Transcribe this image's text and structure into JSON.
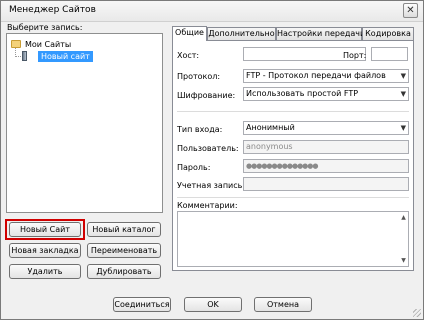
{
  "window": {
    "title": "Менеджер Сайтов",
    "close_glyph": "✕"
  },
  "left": {
    "select_label": "Выберите запись:",
    "tree": [
      {
        "label": "Мои Сайты",
        "icon": "folder-icon"
      },
      {
        "label": "Новый сайт",
        "icon": "site-icon",
        "selected": true
      }
    ],
    "buttons": {
      "new_site": "Новый Сайт",
      "new_folder": "Новый каталог",
      "new_bookmark": "Новая закладка",
      "rename": "Переименовать",
      "delete": "Удалить",
      "duplicate": "Дублировать"
    }
  },
  "tabs": [
    "Общие",
    "Дополнительно",
    "Настройки передачи",
    "Кодировка"
  ],
  "general": {
    "host_label": "Хост:",
    "host_value": "",
    "port_label": "Порт:",
    "port_value": "",
    "protocol_label": "Протокол:",
    "protocol_value": "FTP - Протокол передачи файлов",
    "encryption_label": "Шифрование:",
    "encryption_value": "Использовать простой FTP",
    "logon_label": "Тип входа:",
    "logon_value": "Анонимный",
    "user_label": "Пользователь:",
    "user_value": "anonymous",
    "password_label": "Пароль:",
    "password_value": "●●●●●●●●●●●●●●",
    "account_label": "Учетная запись:",
    "account_value": "",
    "comments_label": "Комментарии:",
    "comments_value": ""
  },
  "footer": {
    "connect": "Соединиться",
    "ok": "OK",
    "cancel": "Отмена"
  },
  "colors": {
    "highlight": "#d00000",
    "selection": "#3399ff"
  }
}
